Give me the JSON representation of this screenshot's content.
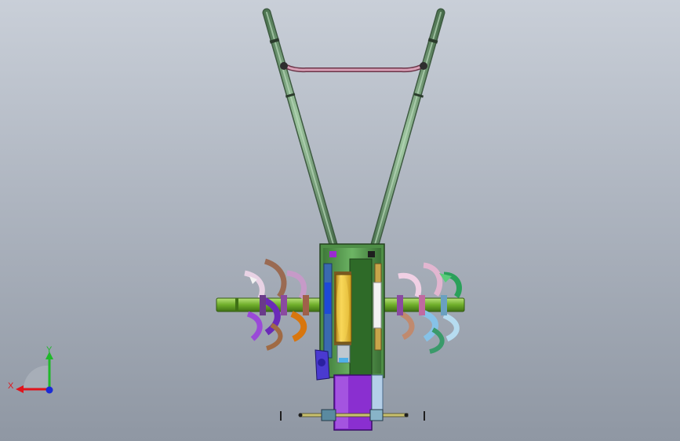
{
  "viewport": {
    "background_top": "#c9cfd8",
    "background_bottom": "#8f97a3"
  },
  "triad": {
    "x_label": "X",
    "y_label": "Y",
    "x_color": "#e0141c",
    "y_color": "#1fb82a",
    "z_color": "#1a2bd6"
  },
  "model": {
    "handle_color": "#6f9a72",
    "crossbar_color": "#c28aa0",
    "shaft_color": "#7fbf3a",
    "frame_color": "#58a050",
    "drum_color": "#e8c030",
    "motor_color": "#8a2fd0"
  }
}
